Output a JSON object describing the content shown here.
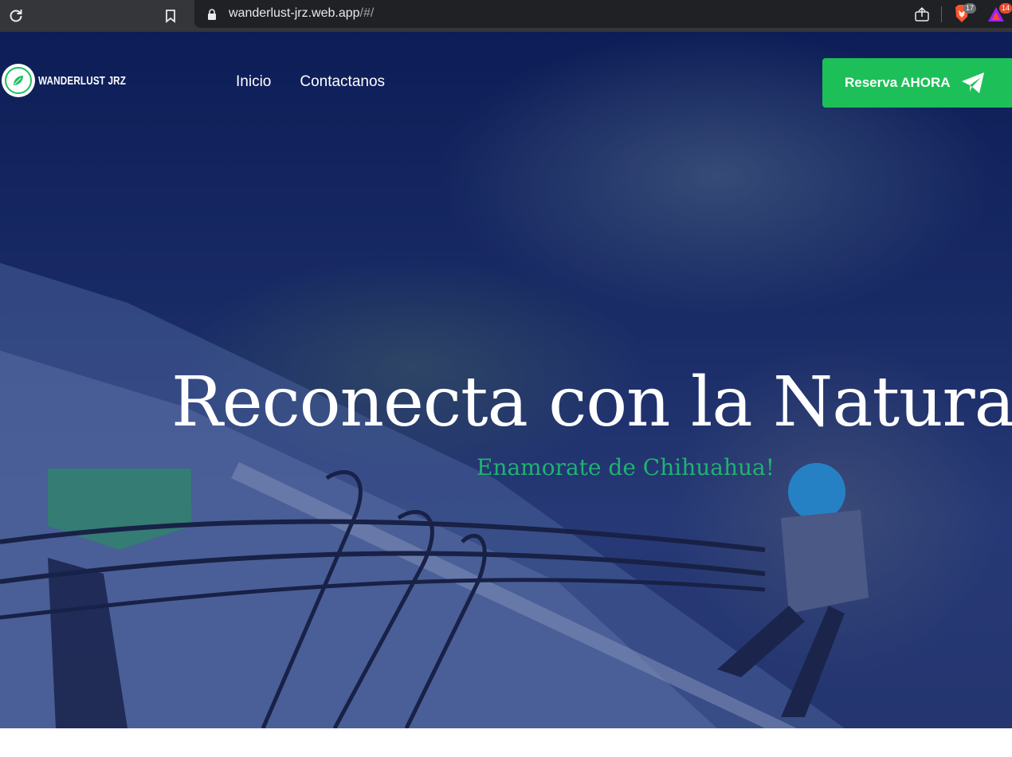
{
  "browser": {
    "url_host": "wanderlust-jrz.web.app",
    "url_path": "/#/",
    "brave_badge": "17",
    "rewards_badge": "14",
    "icons": [
      "reload-icon",
      "bookmark-icon",
      "lock-icon",
      "share-icon",
      "brave-shields-icon",
      "brave-rewards-icon"
    ]
  },
  "site": {
    "logo_text": "WANDERLUST JRZ",
    "nav": [
      {
        "label": "Inicio"
      },
      {
        "label": "Contactanos"
      }
    ],
    "cta_label": "Reserva AHORA",
    "cta_icon": "paper-plane-icon"
  },
  "hero": {
    "title": "Reconecta con la Naturaleza",
    "subtitle": "Enamorate de Chihuahua!"
  },
  "colors": {
    "accent_green": "#1dc058",
    "subtitle_green": "#20b270",
    "hero_overlay": "#14266e"
  }
}
